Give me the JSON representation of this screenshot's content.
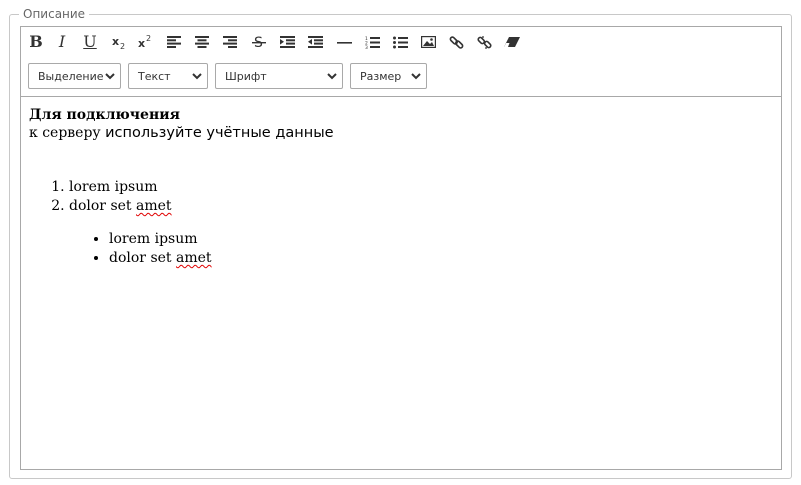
{
  "field": {
    "legend": "Описание"
  },
  "toolbar": {
    "buttons": [
      {
        "name": "bold-button",
        "glyph": "B"
      },
      {
        "name": "italic-button",
        "glyph": "I"
      },
      {
        "name": "underline-button",
        "glyph": "U"
      }
    ],
    "selects": {
      "selection": "Выделение",
      "text": "Текст",
      "font": "Шрифт",
      "size": "Размер"
    }
  },
  "content": {
    "line1_bold": "Для подключения",
    "line2_serif": "к серверу ",
    "line2_sans": "используйте учётные данные",
    "ordered_list": [
      "lorem ipsum",
      "dolor set amet"
    ],
    "unordered_list": [
      "lorem ipsum",
      "dolor set amet"
    ]
  }
}
